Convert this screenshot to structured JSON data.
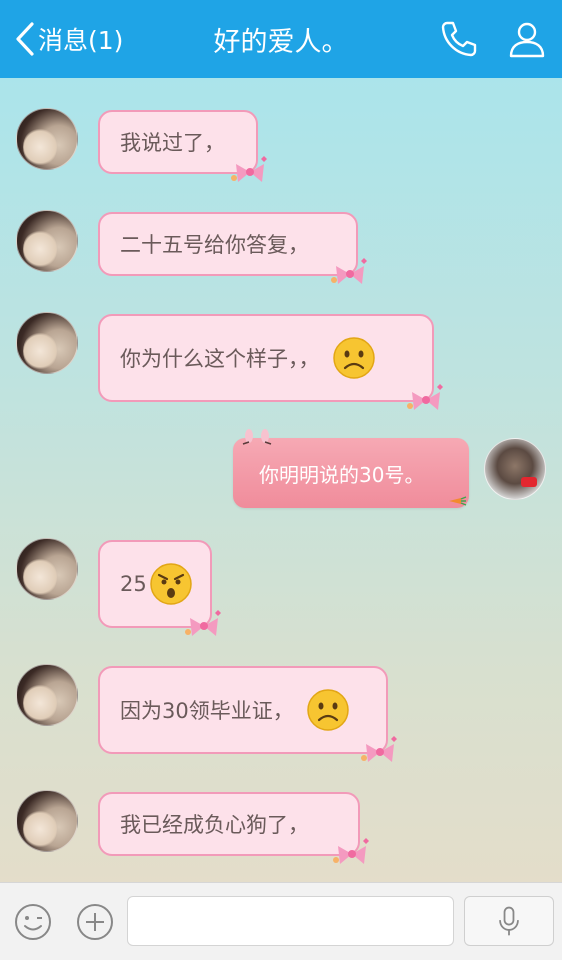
{
  "header": {
    "back_label": "消息(1)",
    "title": "好的爱人。",
    "icons": [
      "back-chevron-icon",
      "phone-icon",
      "person-icon"
    ]
  },
  "messages": [
    {
      "side": "left",
      "text": "我说过了，"
    },
    {
      "side": "left",
      "text": "二十五号给你答复，"
    },
    {
      "side": "left",
      "text": "你为什么这个样子，，",
      "emoji": "sad-face-emoji"
    },
    {
      "side": "right",
      "text": "你明明说的30号。"
    },
    {
      "side": "left",
      "text": "25",
      "emoji": "shocked-face-emoji"
    },
    {
      "side": "left",
      "text": "因为30领毕业证，",
      "emoji": "sad-face-emoji"
    },
    {
      "side": "left",
      "text": "我已经成负心狗了，"
    }
  ],
  "composer": {
    "input_value": "",
    "icons": [
      "emoji-icon",
      "plus-icon",
      "microphone-icon"
    ]
  },
  "colors": {
    "header": "#1fa4e6",
    "bubble_fill": "#fde1ea",
    "bubble_border": "#f29ab9",
    "me_bubble": "#f08c9b"
  }
}
